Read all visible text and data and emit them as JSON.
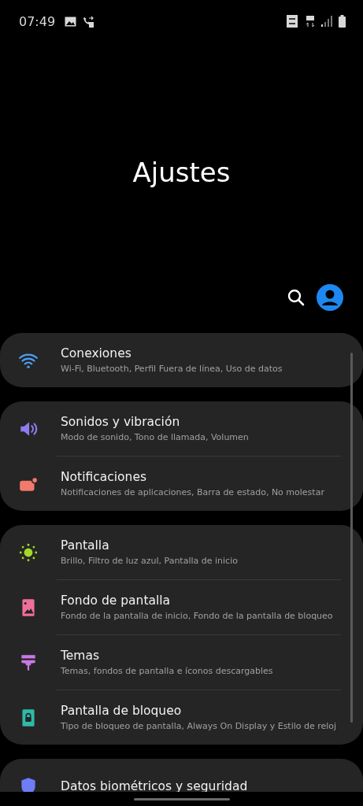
{
  "status_bar": {
    "time": "07:49"
  },
  "header": {
    "title": "Ajustes"
  },
  "groups": [
    {
      "items": [
        {
          "kind": "wifi",
          "color": "#4a9ff5",
          "title": "Conexiones",
          "subtitle": "Wi-Fi, Bluetooth, Perfil Fuera de línea, Uso de datos"
        }
      ]
    },
    {
      "items": [
        {
          "kind": "sound",
          "color": "#8d7cf2",
          "title": "Sonidos y vibración",
          "subtitle": "Modo de sonido, Tono de llamada, Volumen"
        },
        {
          "kind": "notification",
          "color": "#f07a6c",
          "title": "Notificaciones",
          "subtitle": "Notificaciones de aplicaciones, Barra de estado, No molestar"
        }
      ]
    },
    {
      "items": [
        {
          "kind": "display",
          "color": "#a5d82a",
          "title": "Pantalla",
          "subtitle": "Brillo, Filtro de luz azul, Pantalla de inicio"
        },
        {
          "kind": "wallpaper",
          "color": "#ef6f98",
          "title": "Fondo de pantalla",
          "subtitle": "Fondo de la pantalla de inicio, Fondo de la pantalla de bloqueo"
        },
        {
          "kind": "themes",
          "color": "#c979e6",
          "title": "Temas",
          "subtitle": "Temas, fondos de pantalla e íconos descargables"
        },
        {
          "kind": "lock",
          "color": "#2ebaa6",
          "title": "Pantalla de bloqueo",
          "subtitle": "Tipo de bloqueo de pantalla, Always On Display y Estilo de reloj"
        }
      ]
    },
    {
      "items": [
        {
          "kind": "shield",
          "color": "#6f7cf5",
          "title": "Datos biométricos y seguridad"
        }
      ]
    }
  ]
}
